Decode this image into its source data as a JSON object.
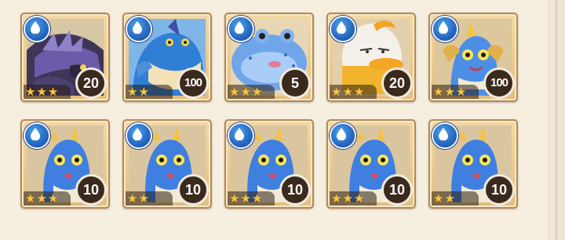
{
  "colors": {
    "background": "#f6eedf",
    "card_border": "#b48a55",
    "water_badge": "#2a74cf",
    "star": "#f6c640",
    "level_badge": "#3a2a1d"
  },
  "monsters": [
    {
      "element_icon": "water-drop-icon",
      "art": "dark-dragon",
      "stars": 3,
      "level": "20"
    },
    {
      "element_icon": "water-drop-icon",
      "art": "blue-shark",
      "stars": 2,
      "level": "100"
    },
    {
      "element_icon": "water-drop-icon",
      "art": "pufferfish",
      "stars": 3,
      "level": "5"
    },
    {
      "element_icon": "water-drop-icon",
      "art": "duck-egg",
      "stars": 3,
      "level": "20"
    },
    {
      "element_icon": "water-drop-icon",
      "art": "sea-dragon",
      "stars": 3,
      "level": "100"
    },
    {
      "element_icon": "water-drop-icon",
      "art": "blue-serpent",
      "stars": 3,
      "level": "10"
    },
    {
      "element_icon": "water-drop-icon",
      "art": "blue-serpent",
      "stars": 2,
      "level": "10"
    },
    {
      "element_icon": "water-drop-icon",
      "art": "blue-serpent",
      "stars": 3,
      "level": "10"
    },
    {
      "element_icon": "water-drop-icon",
      "art": "blue-serpent",
      "stars": 3,
      "level": "10"
    },
    {
      "element_icon": "water-drop-icon",
      "art": "blue-serpent",
      "stars": 2,
      "level": "10"
    }
  ]
}
